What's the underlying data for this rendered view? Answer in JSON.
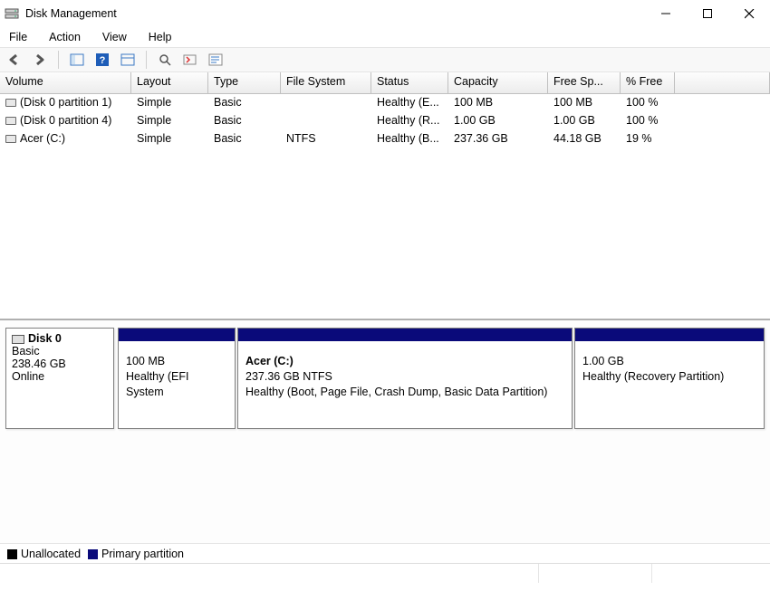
{
  "window": {
    "title": "Disk Management"
  },
  "menu": {
    "file": "File",
    "action": "Action",
    "view": "View",
    "help": "Help"
  },
  "columns": {
    "volume": "Volume",
    "layout": "Layout",
    "type": "Type",
    "filesystem": "File System",
    "status": "Status",
    "capacity": "Capacity",
    "freespace": "Free Sp...",
    "pctfree": "% Free"
  },
  "volumes": [
    {
      "name": "(Disk 0 partition 1)",
      "layout": "Simple",
      "type": "Basic",
      "fs": "",
      "status": "Healthy (E...",
      "capacity": "100 MB",
      "free": "100 MB",
      "pct": "100 %"
    },
    {
      "name": "(Disk 0 partition 4)",
      "layout": "Simple",
      "type": "Basic",
      "fs": "",
      "status": "Healthy (R...",
      "capacity": "1.00 GB",
      "free": "1.00 GB",
      "pct": "100 %"
    },
    {
      "name": "Acer (C:)",
      "layout": "Simple",
      "type": "Basic",
      "fs": "NTFS",
      "status": "Healthy (B...",
      "capacity": "237.36 GB",
      "free": "44.18 GB",
      "pct": "19 %"
    }
  ],
  "disk": {
    "name": "Disk 0",
    "type": "Basic",
    "size": "238.46 GB",
    "state": "Online"
  },
  "partitions": [
    {
      "label": "",
      "line1": "100 MB",
      "line2": "Healthy (EFI System",
      "flex": "0 0 130px"
    },
    {
      "label": "Acer  (C:)",
      "line1": "237.36 GB NTFS",
      "line2": "Healthy (Boot, Page File, Crash Dump, Basic Data Partition)",
      "flex": "1 1 auto"
    },
    {
      "label": "",
      "line1": "1.00 GB",
      "line2": "Healthy (Recovery Partition)",
      "flex": "0 0 210px"
    }
  ],
  "legend": {
    "unallocated": "Unallocated",
    "primary": "Primary partition"
  }
}
